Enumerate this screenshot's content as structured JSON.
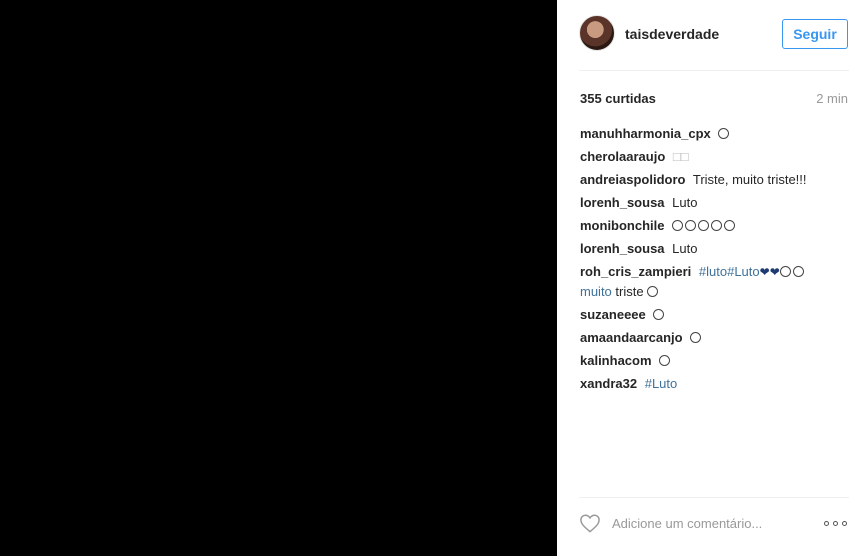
{
  "post": {
    "username": "taisdeverdade",
    "follow_label": "Seguir",
    "likes": "355 curtidas",
    "time_ago": "2 min"
  },
  "comments": [
    {
      "user": "manuhharmonia_cpx",
      "text": "",
      "emoji": "sad-face"
    },
    {
      "user": "cherolaaraujo",
      "text": "□□",
      "emoji": ""
    },
    {
      "user": "andreiaspolidoro",
      "text": "Triste, muito triste!!!",
      "emoji": ""
    },
    {
      "user": "lorenh_sousa",
      "text": "Luto",
      "emoji": ""
    },
    {
      "user": "monibonchile",
      "text": "",
      "emoji": "sad-faces"
    },
    {
      "user": "lorenh_sousa",
      "text": "Luto",
      "emoji": ""
    },
    {
      "user": "roh_cris_zampieri",
      "hashtags": "#luto#Luto",
      "text": "muito triste",
      "emoji": "broken-hearts"
    },
    {
      "user": "suzaneeee",
      "text": "",
      "emoji": "sad-face"
    },
    {
      "user": "amaandaarcanjo",
      "text": "",
      "emoji": "sad-face"
    },
    {
      "user": "kalinhacom",
      "text": "",
      "emoji": "sad-face"
    },
    {
      "user": "xandra32",
      "text": "#Luto",
      "emoji": ""
    }
  ],
  "footer": {
    "comment_placeholder": "Adicione um comentário...",
    "like_icon": "heart-outline-icon",
    "more_icon": "more-options-icon"
  },
  "colors": {
    "accent": "#3897f0",
    "hashtag": "#3f729b",
    "muted": "#999999"
  }
}
